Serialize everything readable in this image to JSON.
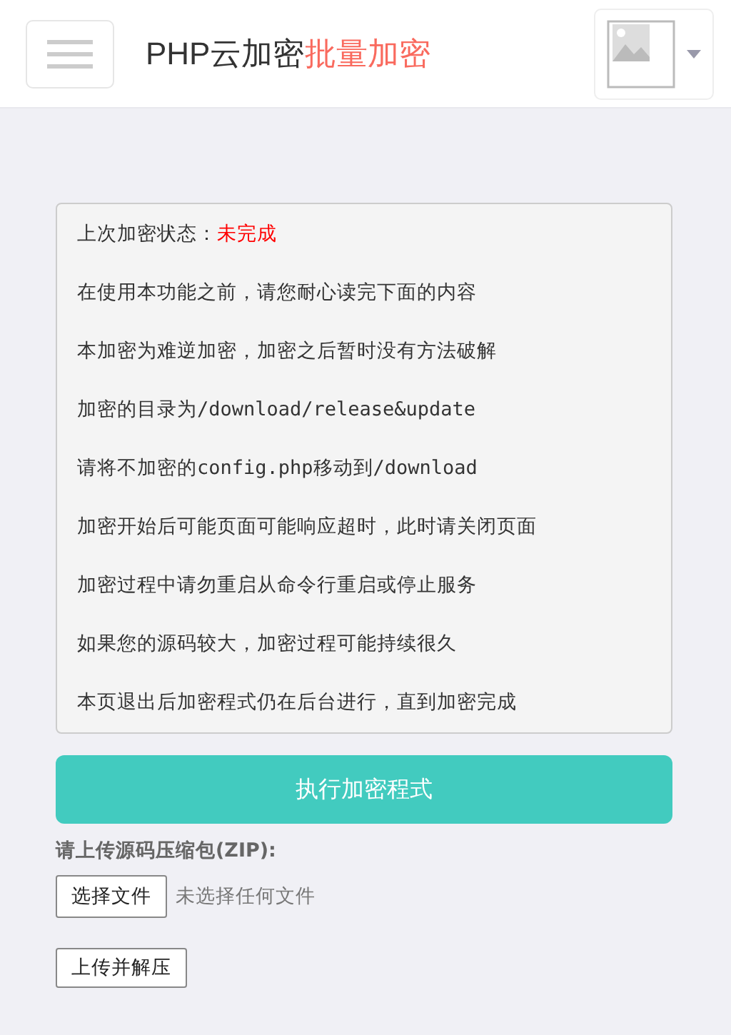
{
  "header": {
    "title": "PHP云加密",
    "title_highlight": "批量加密"
  },
  "notice": {
    "status_label": "上次加密状态：",
    "status_value": "未完成",
    "lines": [
      "在使用本功能之前，请您耐心读完下面的内容",
      "本加密为难逆加密，加密之后暂时没有方法破解",
      "加密的目录为/download/release&update",
      "请将不加密的config.php移动到/download",
      "加密开始后可能页面可能响应超时，此时请关闭页面",
      "加密过程中请勿重启从命令行重启或停止服务",
      "如果您的源码较大，加密过程可能持续很久",
      "本页退出后加密程式仍在后台进行，直到加密完成"
    ]
  },
  "run_button": "执行加密程式",
  "upload": {
    "label": "请上传源码压缩包(ZIP):",
    "choose_button": "选择文件",
    "no_file": "未选择任何文件",
    "submit_button": "上传并解压"
  }
}
